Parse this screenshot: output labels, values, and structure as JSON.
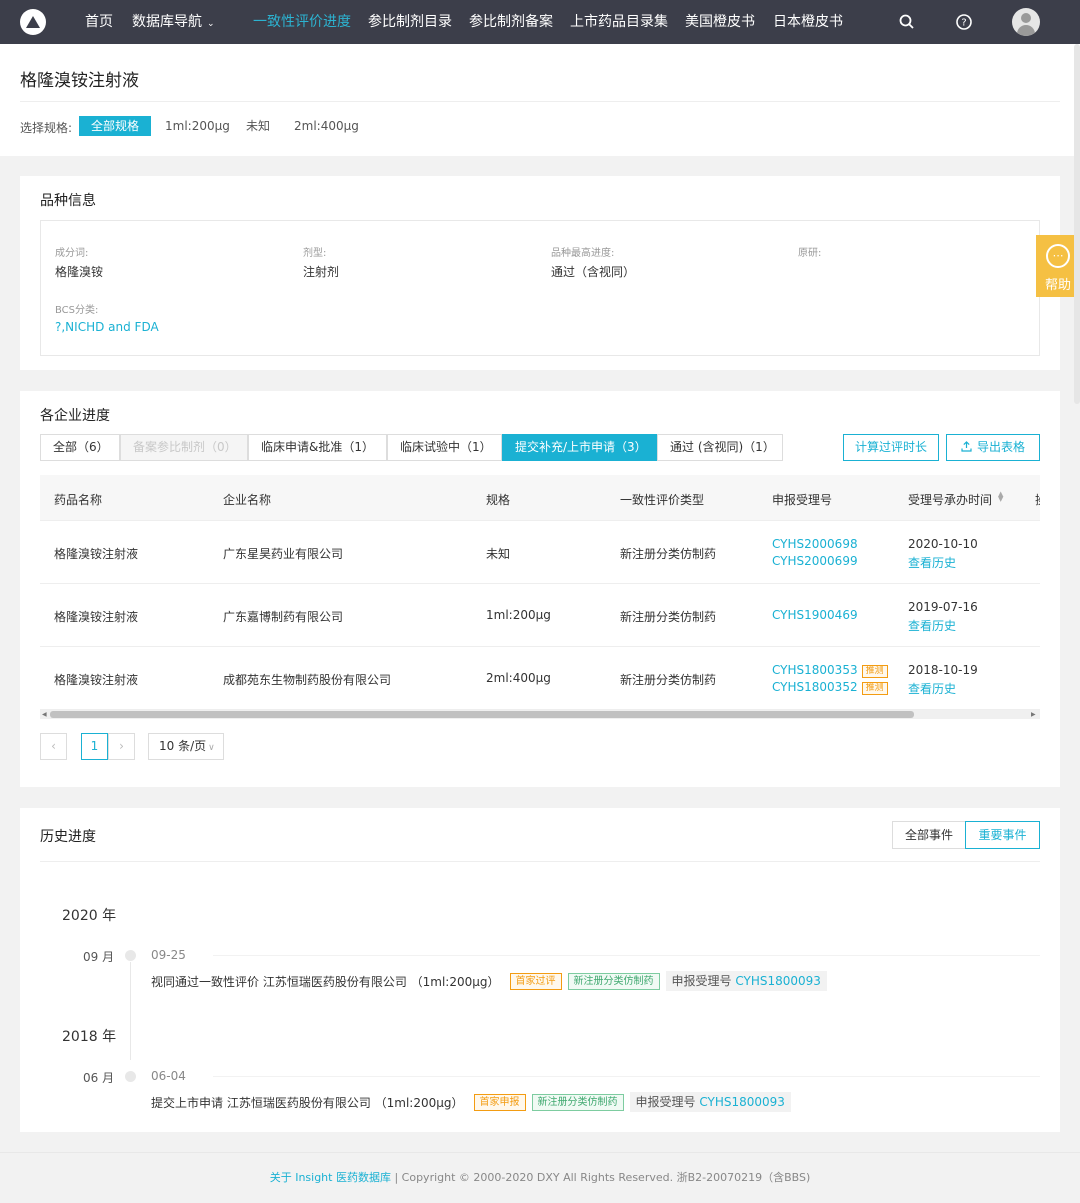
{
  "nav": {
    "items": [
      "首页",
      "数据库导航",
      "一致性评价进度",
      "参比制剂目录",
      "参比制剂备案",
      "上市药品目录集",
      "美国橙皮书",
      "日本橙皮书"
    ],
    "dropdown_icon": "chevron-down-icon"
  },
  "page": {
    "title": "格隆溴铵注射液",
    "spec_label": "选择规格:",
    "specs": [
      "全部规格",
      "1ml:200μg",
      "未知",
      "2ml:400μg"
    ],
    "selected_spec": "全部规格"
  },
  "variety": {
    "title": "品种信息",
    "fields": [
      {
        "label": "成分词:",
        "value": "格隆溴铵"
      },
      {
        "label": "剂型:",
        "value": "注射剂"
      },
      {
        "label": "品种最高进度:",
        "value": "通过（含视同）"
      },
      {
        "label": "原研:",
        "value": ""
      },
      {
        "label": "BCS分类:",
        "value": "?,NICHD and FDA"
      }
    ]
  },
  "progress": {
    "title": "各企业进度",
    "tabs": [
      "全部（6）",
      "备案参比制剂（0）",
      "临床申请&批准（1）",
      "临床试验中（1）",
      "提交补充/上市申请（3）",
      "通过 (含视同)（1）"
    ],
    "active_tab": "提交补充/上市申请（3）",
    "calc_button": "计算过评时长",
    "export_button": "导出表格",
    "columns": [
      "药品名称",
      "企业名称",
      "规格",
      "一致性评价类型",
      "申报受理号",
      "受理号承办时间",
      "操"
    ],
    "rows": [
      {
        "drug": "格隆溴铵注射液",
        "company": "广东星昊药业有限公司",
        "spec": "未知",
        "type": "新注册分类仿制药",
        "nos": [
          "CYHS2000698",
          "CYHS2000699"
        ],
        "tui": [
          false,
          false
        ],
        "date": "2020-10-10",
        "history": "查看历史"
      },
      {
        "drug": "格隆溴铵注射液",
        "company": "广东嘉博制药有限公司",
        "spec": "1ml:200μg",
        "type": "新注册分类仿制药",
        "nos": [
          "CYHS1900469"
        ],
        "tui": [
          false
        ],
        "date": "2019-07-16",
        "history": "查看历史"
      },
      {
        "drug": "格隆溴铵注射液",
        "company": "成都苑东生物制药股份有限公司",
        "spec": "2ml:400μg",
        "type": "新注册分类仿制药",
        "nos": [
          "CYHS1800353",
          "CYHS1800352"
        ],
        "tui": [
          true,
          true
        ],
        "date": "2018-10-19",
        "history": "查看历史"
      }
    ],
    "tui_label": "推测",
    "pagination": {
      "current": "1",
      "page_size": "10 条/页"
    }
  },
  "history": {
    "title": "历史进度",
    "filters": [
      "全部事件",
      "重要事件"
    ],
    "active_filter": "重要事件",
    "groups": [
      {
        "year": "2020 年",
        "month": "09 月",
        "date": "09-25",
        "text": "视同通过一致性评价 江苏恒瑞医药股份有限公司 （1ml:200μg）",
        "badge1": "首家过评",
        "badge2": "新注册分类仿制药",
        "acc_label": "申报受理号",
        "acc_no": "CYHS1800093"
      },
      {
        "year": "2018 年",
        "month": "06 月",
        "date": "06-04",
        "text": "提交上市申请 江苏恒瑞医药股份有限公司 （1ml:200μg）",
        "badge1": "首家申报",
        "badge2": "新注册分类仿制药",
        "acc_label": "申报受理号",
        "acc_no": "CYHS1800093"
      }
    ]
  },
  "help": {
    "label": "帮助"
  },
  "footer": {
    "link": "关于 Insight 医药数据库",
    "text": " | Copyright © 2000-2020 DXY All Rights Reserved. 浙B2-20070219（含BBS)"
  },
  "colors": {
    "accent": "#1ab1d3",
    "topbar": "#3c3e4a",
    "help": "#f5c043",
    "orange": "#f39c12",
    "green": "#3fa86f"
  }
}
